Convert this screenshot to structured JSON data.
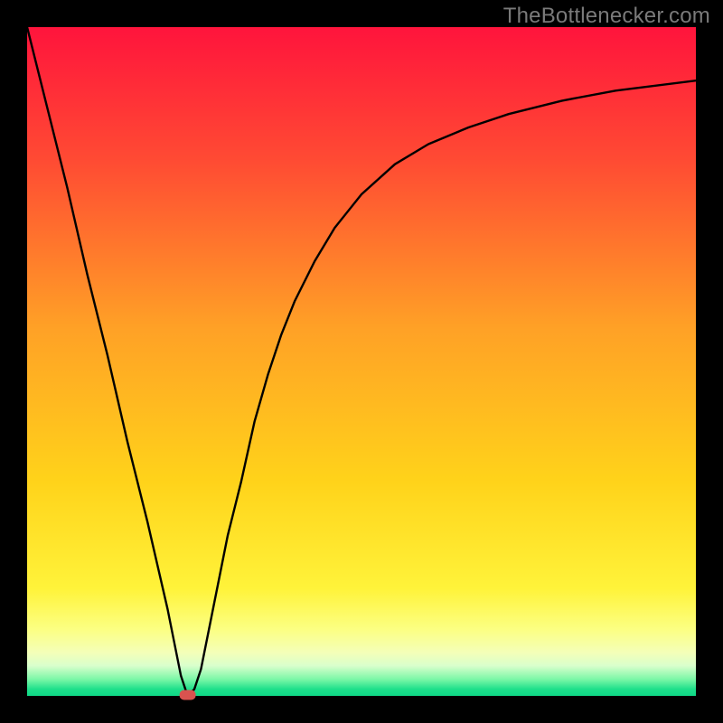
{
  "watermark": {
    "text": "TheBottlenecker.com"
  },
  "chart_meta": {
    "frame": {
      "outer_size": 800,
      "border": 30,
      "inner_origin": 30,
      "inner_size": 740
    },
    "colors": {
      "border": "#000000",
      "curve": "#000000",
      "marker_fill": "#d9534f",
      "gradient_stops": [
        {
          "offset": 0.0,
          "color": "#ff143c"
        },
        {
          "offset": 0.2,
          "color": "#ff4b33"
        },
        {
          "offset": 0.45,
          "color": "#ffa126"
        },
        {
          "offset": 0.68,
          "color": "#ffd31a"
        },
        {
          "offset": 0.84,
          "color": "#fff33a"
        },
        {
          "offset": 0.9,
          "color": "#fcff82"
        },
        {
          "offset": 0.935,
          "color": "#f4ffb8"
        },
        {
          "offset": 0.955,
          "color": "#d9ffcc"
        },
        {
          "offset": 0.975,
          "color": "#7cf7a7"
        },
        {
          "offset": 0.99,
          "color": "#1ee08b"
        },
        {
          "offset": 1.0,
          "color": "#0fd987"
        }
      ]
    }
  },
  "chart_data": {
    "type": "line",
    "title": "",
    "xlabel": "",
    "ylabel": "",
    "xlim": [
      0,
      100
    ],
    "ylim": [
      0,
      100
    ],
    "marker": {
      "x": 24,
      "y": 0
    },
    "series": [
      {
        "name": "bottleneck-curve",
        "points": [
          {
            "x": 0,
            "y": 100
          },
          {
            "x": 3,
            "y": 88
          },
          {
            "x": 6,
            "y": 76
          },
          {
            "x": 9,
            "y": 63
          },
          {
            "x": 12,
            "y": 51
          },
          {
            "x": 15,
            "y": 38
          },
          {
            "x": 18,
            "y": 26
          },
          {
            "x": 21,
            "y": 13
          },
          {
            "x": 23,
            "y": 3
          },
          {
            "x": 24,
            "y": 0
          },
          {
            "x": 25,
            "y": 1
          },
          {
            "x": 26,
            "y": 4
          },
          {
            "x": 27,
            "y": 9
          },
          {
            "x": 28,
            "y": 14
          },
          {
            "x": 29,
            "y": 19
          },
          {
            "x": 30,
            "y": 24
          },
          {
            "x": 32,
            "y": 32
          },
          {
            "x": 34,
            "y": 41
          },
          {
            "x": 36,
            "y": 48
          },
          {
            "x": 38,
            "y": 54
          },
          {
            "x": 40,
            "y": 59
          },
          {
            "x": 43,
            "y": 65
          },
          {
            "x": 46,
            "y": 70
          },
          {
            "x": 50,
            "y": 75
          },
          {
            "x": 55,
            "y": 79.5
          },
          {
            "x": 60,
            "y": 82.5
          },
          {
            "x": 66,
            "y": 85
          },
          {
            "x": 72,
            "y": 87
          },
          {
            "x": 80,
            "y": 89
          },
          {
            "x": 88,
            "y": 90.5
          },
          {
            "x": 100,
            "y": 92
          }
        ]
      }
    ]
  }
}
